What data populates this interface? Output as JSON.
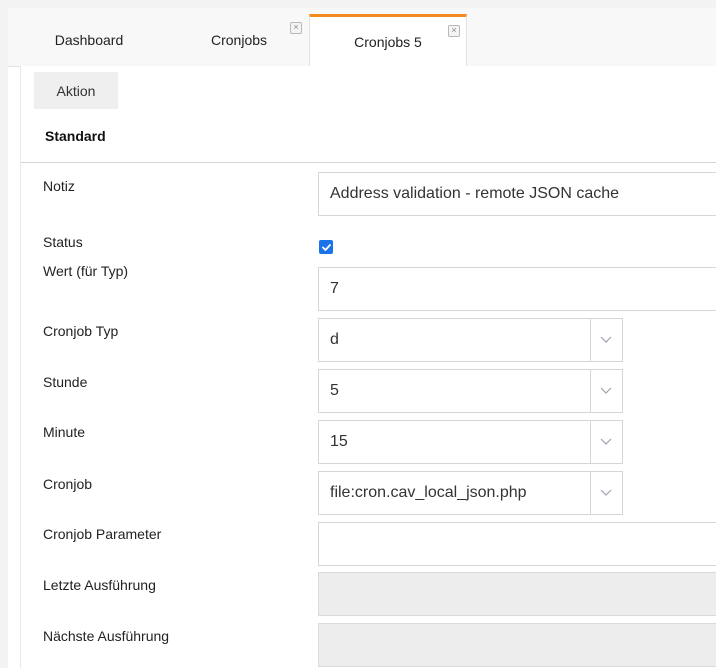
{
  "tabs": [
    {
      "label": "Dashboard",
      "closable": false,
      "active": false
    },
    {
      "label": "Cronjobs",
      "closable": true,
      "active": false
    },
    {
      "label": "Cronjobs 5",
      "closable": true,
      "active": true
    }
  ],
  "toolbar": {
    "action_label": "Aktion"
  },
  "section": {
    "title": "Standard"
  },
  "form": {
    "notiz": {
      "label": "Notiz",
      "value": "Address validation - remote JSON cache"
    },
    "status": {
      "label": "Status",
      "checked": true
    },
    "wert": {
      "label": "Wert (für Typ)",
      "value": "7"
    },
    "typ": {
      "label": "Cronjob Typ",
      "value": "d"
    },
    "stunde": {
      "label": "Stunde",
      "value": "5"
    },
    "minute": {
      "label": "Minute",
      "value": "15"
    },
    "cronjob": {
      "label": "Cronjob",
      "value": "file:cron.cav_local_json.php"
    },
    "parameter": {
      "label": "Cronjob Parameter",
      "value": ""
    },
    "letzte": {
      "label": "Letzte Ausführung",
      "value": ""
    },
    "naechste": {
      "label": "Nächste Ausführung",
      "value": ""
    }
  },
  "colors": {
    "accent_tab": "#f28a1e",
    "checkbox": "#1a73e8"
  },
  "icons": {
    "tab_close": "close-icon",
    "dropdown": "chevron-down-icon",
    "check": "check-icon"
  }
}
